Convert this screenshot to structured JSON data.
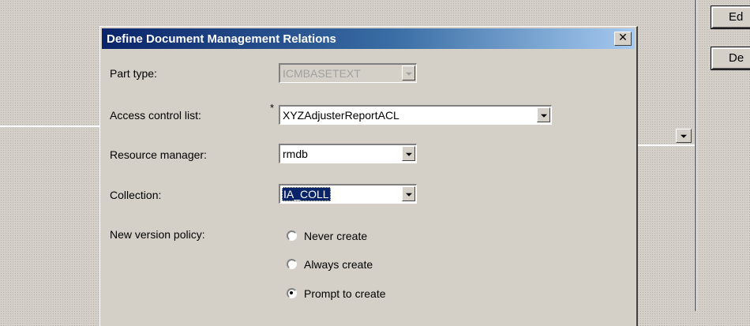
{
  "background": {
    "buttons": [
      {
        "label": "Ed",
        "mnemonic_index": 0
      },
      {
        "label": "De",
        "mnemonic_index": -1
      }
    ]
  },
  "dialog": {
    "title": "Define Document Management Relations",
    "close_glyph": "✕",
    "fields": {
      "part_type": {
        "label": "Part type:",
        "value": "ICMBASETEXT",
        "disabled": true
      },
      "acl": {
        "label": "Access control list:",
        "required_mark": "*",
        "value": "XYZAdjusterReportACL"
      },
      "resource_manager": {
        "label": "Resource manager:",
        "value": "rmdb"
      },
      "collection": {
        "label": "Collection:",
        "value": "IA_COLL",
        "selected": true
      }
    },
    "version_policy": {
      "label": "New version policy:",
      "options": [
        {
          "label": "Never create",
          "checked": false
        },
        {
          "label": "Always create",
          "checked": false
        },
        {
          "label": "Prompt to create",
          "checked": true
        }
      ]
    }
  },
  "colors": {
    "window_face": "#d4d0c8",
    "titlebar_start": "#0a246a",
    "titlebar_end": "#a6caf0",
    "selection": "#0a246a"
  },
  "icons": {
    "dropdown": "chevron-down-icon",
    "close": "close-icon",
    "radio": "radio-icon"
  }
}
